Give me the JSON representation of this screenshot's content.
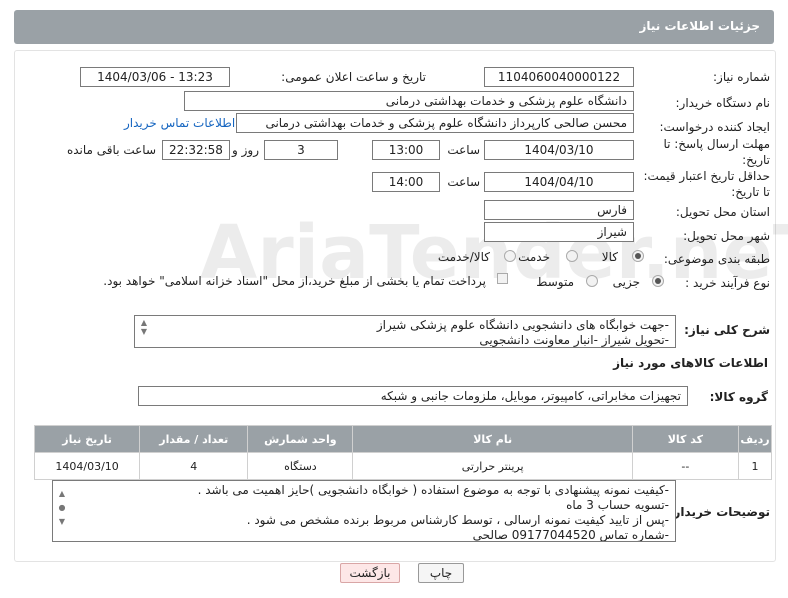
{
  "header": {
    "title": "جزئیات اطلاعات نیاز"
  },
  "form": {
    "need_number_label": "شماره نیاز:",
    "need_number": "1104060040000122",
    "announce_label": "تاریخ و ساعت اعلان عمومی:",
    "announce_value": "1404/03/06 - 13:23",
    "buyer_org_label": "نام دستگاه خریدار:",
    "buyer_org": "دانشگاه علوم پزشکی و خدمات بهداشتی درمانی",
    "requester_label": "ایجاد کننده درخواست:",
    "requester": "محسن صالحی کارپرداز دانشگاه علوم پزشکی و خدمات بهداشتی درمانی",
    "contact_link": "اطلاعات تماس خریدار",
    "reply_deadline_label": "مهلت ارسال پاسخ: تا تاریخ:",
    "reply_date": "1404/03/10",
    "time_label": "ساعت",
    "reply_time": "13:00",
    "days": "3",
    "days_label": "روز و",
    "remaining": "22:32:58",
    "remaining_label": "ساعت باقی مانده",
    "price_deadline_label": "حداقل تاریخ اعتبار قیمت: تا تاریخ:",
    "price_date": "1404/04/10",
    "price_time": "14:00",
    "province_label": "استان محل تحویل:",
    "province": "فارس",
    "city_label": "شهر محل تحویل:",
    "city": "شیراز",
    "category_label": "طبقه بندی موضوعی:",
    "category_options": [
      "کالا",
      "خدمت",
      "کالا/خدمت"
    ],
    "category_selected": "کالا",
    "process_label": "نوع فرآیند خرید :",
    "process_options": [
      "جزیی",
      "متوسط"
    ],
    "process_selected": "جزیی",
    "payment_note": "پرداخت تمام یا بخشی از مبلغ خرید،از محل \"اسناد خزانه اسلامی\" خواهد بود."
  },
  "description": {
    "label": "شرح کلی نیاز:",
    "lines": [
      "-جهت خوابگاه های دانشجویی دانشگاه علوم پزشکی شیراز",
      "-تحویل شیراز -انبار معاونت دانشجویی"
    ]
  },
  "goods": {
    "section_title": "اطلاعات کالاهای مورد نیاز",
    "group_label": "گروه کالا:",
    "group_value": "تجهیزات مخابراتی، کامپیوتر، موبایل، ملزومات جانبی و شبکه",
    "columns": [
      "ردیف",
      "کد کالا",
      "نام کالا",
      "واحد شمارش",
      "تعداد / مقدار",
      "تاریخ نیاز"
    ],
    "rows": [
      {
        "row": "1",
        "code": "--",
        "name": "پرینتر حرارتی",
        "unit": "دستگاه",
        "qty": "4",
        "date": "1404/03/10"
      }
    ]
  },
  "buyer_notes": {
    "label": "توضیحات خریدار:",
    "lines": [
      "-کیفیت نمونه پیشنهادی با توجه به موضوع استفاده ( خوابگاه دانشجویی )حایز اهمیت می باشد .",
      "-تسویه حساب 3 ماه",
      "-پس از تایید کیفیت نمونه ارسالی ، توسط کارشناس مربوط برنده مشخص می شود .",
      "-شماره تماس 09177044520 صالحی"
    ]
  },
  "buttons": {
    "print": "چاپ",
    "back": "بازگشت"
  },
  "watermark": "AriaTender.neT"
}
